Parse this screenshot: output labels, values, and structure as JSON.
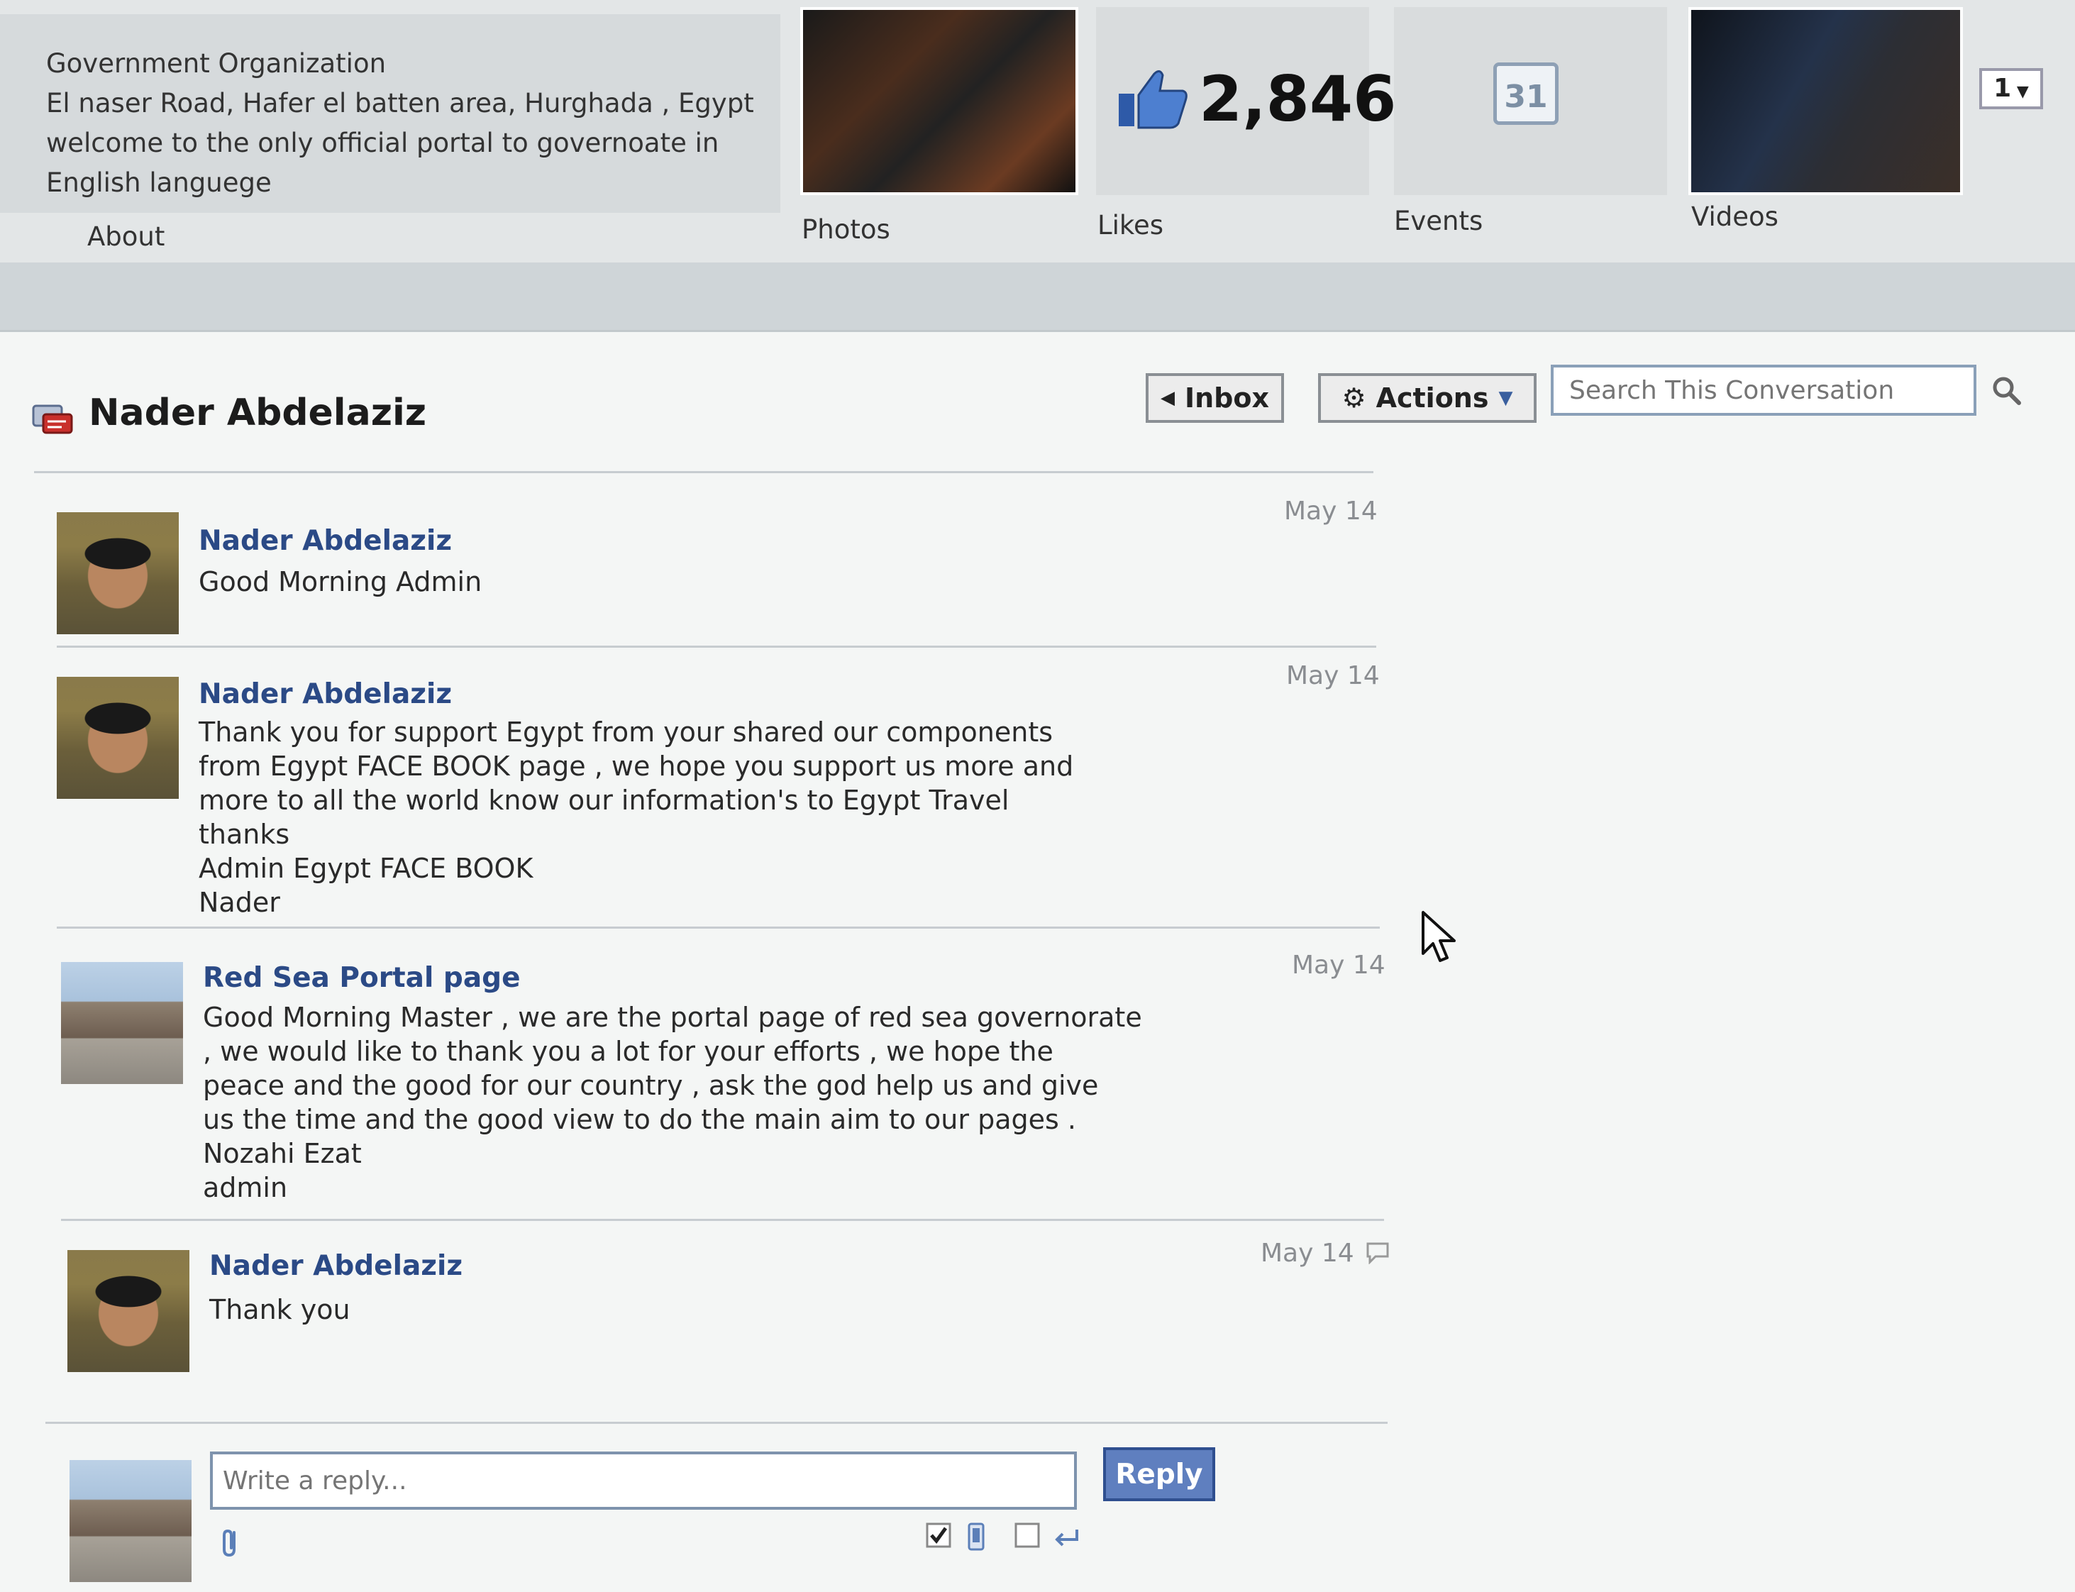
{
  "page_info": {
    "category": "Government Organization",
    "address": "El naser Road, Hafer el batten area, Hurghada , Egypt",
    "description_line1": "welcome to the only official portal to governoate in",
    "description_line2": "English languege"
  },
  "tabs": {
    "about": "About",
    "photos": "Photos",
    "likes": "Likes",
    "events": "Events",
    "videos": "Videos"
  },
  "likes_count": "2,846",
  "calendar_day": "31",
  "page_select_value": "1",
  "conversation": {
    "title": "Nader Abdelaziz",
    "inbox_label": "Inbox",
    "actions_label": "Actions",
    "search_placeholder": "Search This Conversation"
  },
  "messages": [
    {
      "sender": "Nader Abdelaziz",
      "date": "May 14",
      "lines": [
        "Good Morning Admin"
      ]
    },
    {
      "sender": "Nader Abdelaziz",
      "date": "May 14",
      "lines": [
        "Thank you for support Egypt from your shared our components",
        "from Egypt FACE BOOK page , we hope you support us more and",
        "more to all the world know our information's to Egypt Travel",
        "thanks",
        "Admin Egypt FACE BOOK",
        "Nader"
      ]
    },
    {
      "sender": "Red Sea Portal page",
      "date": "May 14",
      "lines": [
        "Good Morning Master , we are the portal page of red sea governorate",
        ", we would like to thank you a lot for your efforts , we hope the",
        "peace and the good for our country , ask the god help us and give",
        "us the time and the good view to do the main aim to our pages .",
        "Nozahi Ezat",
        "admin"
      ]
    },
    {
      "sender": "Nader Abdelaziz",
      "date": "May 14",
      "lines": [
        "Thank you"
      ]
    }
  ],
  "reply": {
    "placeholder": "Write a reply...",
    "button_label": "Reply"
  }
}
